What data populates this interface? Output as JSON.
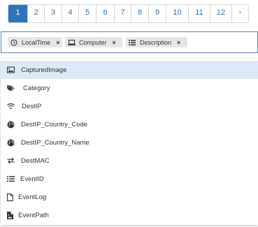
{
  "pagination": {
    "pages": [
      "1",
      "2",
      "3",
      "4",
      "5",
      "6",
      "7",
      "8",
      "9",
      "10",
      "11",
      "12"
    ],
    "active": "1",
    "next_label": "›"
  },
  "filter_chips": [
    {
      "label": "LocalTime",
      "icon": "clock-icon"
    },
    {
      "label": "Computer",
      "icon": "laptop-icon"
    },
    {
      "label": "Description",
      "icon": "list-icon"
    }
  ],
  "chip_close_label": "×",
  "dropdown": {
    "options": [
      {
        "label": "CapturedImage",
        "icon": "image-icon"
      },
      {
        "label": "Category",
        "icon": "tags-icon"
      },
      {
        "label": "DestIP",
        "icon": "wifi-icon"
      },
      {
        "label": "DestIP_Country_Code",
        "icon": "globe-icon"
      },
      {
        "label": "DestIP_Country_Name",
        "icon": "globe-icon"
      },
      {
        "label": "DestMAC",
        "icon": "exchange-icon"
      },
      {
        "label": "EventID",
        "icon": "list-ol-icon"
      },
      {
        "label": "EventLog",
        "icon": "file-icon"
      },
      {
        "label": "EventPath",
        "icon": "file-image-icon"
      }
    ],
    "highlighted_index": 0
  },
  "colors": {
    "accent": "#2f74b5",
    "highlight": "#dce9f7",
    "chip_bg": "#e6e6e6",
    "border": "#4d86c2"
  }
}
